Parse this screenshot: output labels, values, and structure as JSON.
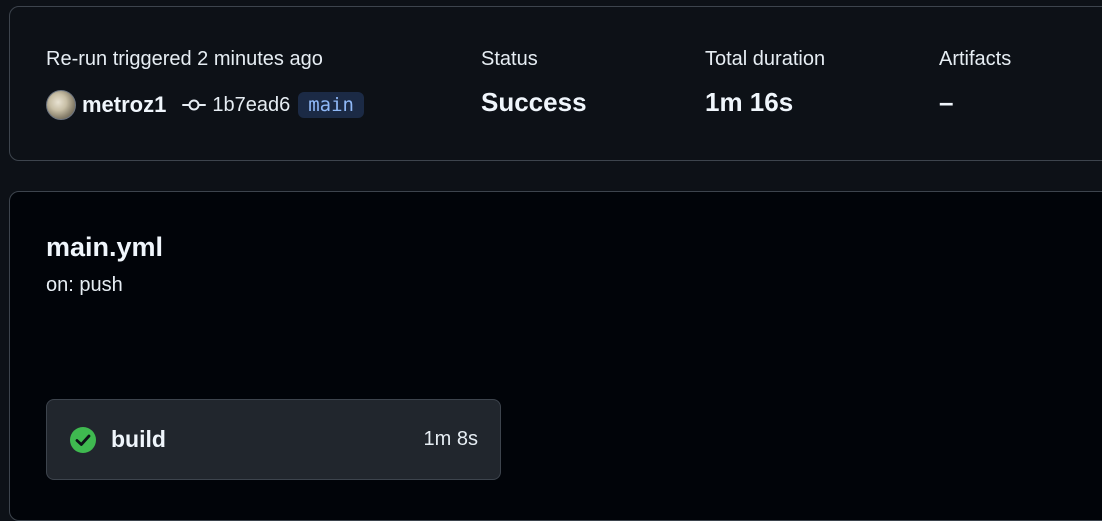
{
  "summary": {
    "trigger_text": "Re-run triggered 2 minutes ago",
    "actor": "metroz1",
    "commit_sha": "1b7ead6",
    "branch": "main",
    "status_label": "Status",
    "status_value": "Success",
    "duration_label": "Total duration",
    "duration_value": "1m 16s",
    "artifacts_label": "Artifacts",
    "artifacts_value": "–"
  },
  "workflow": {
    "file": "main.yml",
    "trigger": "on: push",
    "jobs": [
      {
        "name": "build",
        "duration": "1m 8s",
        "status": "success",
        "status_icon": "check-circle-icon",
        "status_color": "#3fb950"
      }
    ]
  }
}
